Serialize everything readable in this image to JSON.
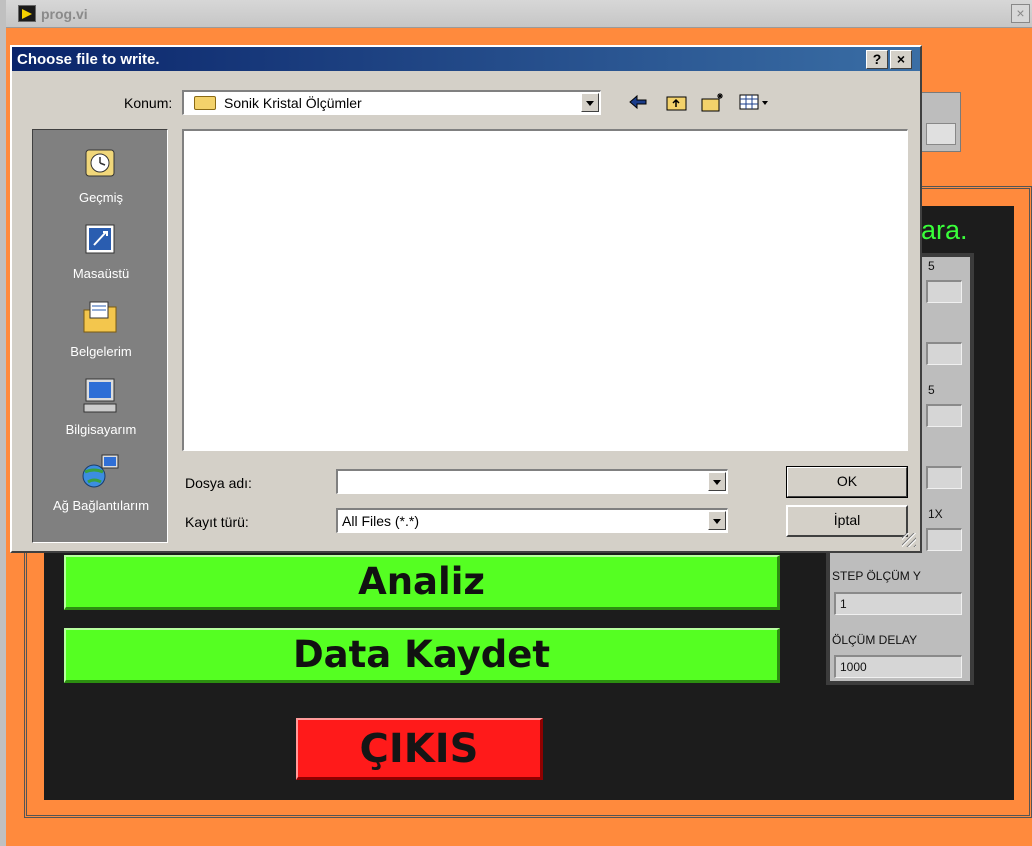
{
  "main_window": {
    "title": "prog.vi",
    "close_label": "×",
    "side_text": "ara.",
    "buttons": {
      "analiz": "Analiz",
      "data_kaydet": "Data Kaydet",
      "cikis": "ÇIKIS"
    },
    "params": {
      "partial_labels": [
        "5",
        "5",
        "1X"
      ],
      "step_y_label": "STEP ÖLÇÜM Y",
      "step_y_value": "1",
      "delay_label": "ÖLÇÜM DELAY",
      "delay_value": "1000"
    }
  },
  "dialog": {
    "title": "Choose file to write.",
    "help_label": "?",
    "close_label": "×",
    "location_label": "Konum:",
    "location_value": "Sonik Kristal Ölçümler",
    "toolbar_icons": [
      "back-icon",
      "up-folder-icon",
      "new-folder-icon",
      "view-menu-icon"
    ],
    "places": [
      {
        "label": "Geçmiş",
        "icon": "history-icon"
      },
      {
        "label": "Masaüstü",
        "icon": "desktop-icon"
      },
      {
        "label": "Belgelerim",
        "icon": "my-documents-icon"
      },
      {
        "label": "Bilgisayarım",
        "icon": "my-computer-icon"
      },
      {
        "label": "Ağ Bağlantılarım",
        "icon": "network-icon"
      }
    ],
    "filename_label": "Dosya adı:",
    "filename_value": "",
    "filetype_label": "Kayıt türü:",
    "filetype_value": "All Files (*.*)",
    "ok_label": "OK",
    "cancel_label": "İptal"
  },
  "colors": {
    "background_orange": "#ff8a3d",
    "button_green": "#55ff22",
    "button_red": "#ff1a1a",
    "title_blue": "#0a246a"
  }
}
